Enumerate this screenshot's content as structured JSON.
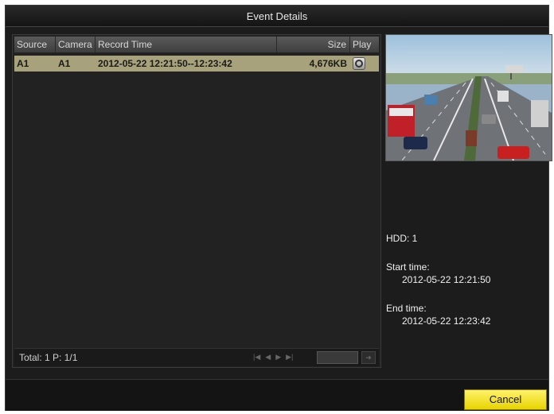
{
  "window": {
    "title": "Event Details"
  },
  "table": {
    "headers": [
      "Source",
      "Camera",
      "Record Time",
      "Size",
      "Play"
    ],
    "rows": [
      {
        "source": "A1",
        "camera": "A1",
        "record_time": "2012-05-22 12:21:50--12:23:42",
        "size": "4,676KB",
        "play_icon": "play-icon"
      }
    ]
  },
  "footer": {
    "total_text": "Total: 1  P: 1/1",
    "pager_icons": [
      "first-page-icon",
      "prev-page-icon",
      "next-page-icon",
      "last-page-icon"
    ],
    "go_icon": "go-icon"
  },
  "details": {
    "hdd": "HDD: 1",
    "start_label": "Start time:",
    "start_value": "2012-05-22 12:21:50",
    "end_label": "End time:",
    "end_value": "2012-05-22 12:23:42"
  },
  "buttons": {
    "cancel": "Cancel"
  },
  "colors": {
    "selected_row": "#a7a27c",
    "cancel_button": "#f3e21a",
    "background": "#1c1c1c"
  }
}
